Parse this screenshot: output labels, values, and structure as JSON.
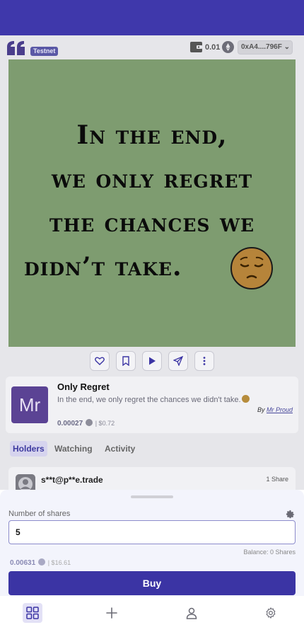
{
  "header": {
    "badge": "Testnet",
    "balance": "0.01",
    "address": "0xA4....796F",
    "address_chevron": "⌄"
  },
  "post": {
    "quote_lines": [
      "In the end,",
      "we only regret",
      "the chances we",
      "didn’t take."
    ],
    "title": "Only Regret",
    "description": "In the end, we only regret the chances we didn't take.",
    "author_prefix": "By",
    "author": "Mr Proud",
    "price": "0.00027",
    "price_usd": "| $0.72",
    "avatar_initials": "Mr"
  },
  "actions": [
    "heart-icon",
    "bookmark-icon",
    "play-icon",
    "send-icon",
    "more-vertical-icon"
  ],
  "tabs": [
    {
      "label": "Holders",
      "active": true
    },
    {
      "label": "Watching",
      "active": false
    },
    {
      "label": "Activity",
      "active": false
    }
  ],
  "holders": [
    {
      "name": "s**t@p**e.trade",
      "shares": "1 Share"
    }
  ],
  "buy_sheet": {
    "shares_label": "Number of shares",
    "shares_value": "5",
    "balance_label": "Balance: 0 Shares",
    "total": "0.00631",
    "total_usd": "| $16.61",
    "buy_label": "Buy"
  },
  "bottom_nav": [
    "grid-icon",
    "plus-icon",
    "user-icon",
    "settings-icon"
  ],
  "colors": {
    "accent": "#3b34a4",
    "status_bar": "#3f38ab",
    "image_bg": "#7e9c70",
    "avatar": "#5b4394"
  }
}
